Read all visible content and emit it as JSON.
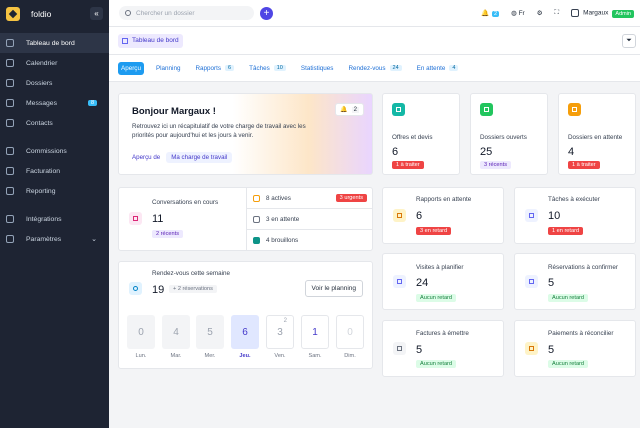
{
  "brand": "foldio",
  "sidebar": {
    "items": [
      {
        "label": "Tableau de bord",
        "active": true
      },
      {
        "label": "Calendrier"
      },
      {
        "label": "Dossiers"
      },
      {
        "label": "Messages",
        "badge": "8"
      },
      {
        "label": "Contacts"
      },
      {
        "label": "Commissions"
      },
      {
        "label": "Facturation"
      },
      {
        "label": "Reporting"
      },
      {
        "label": "Intégrations"
      },
      {
        "label": "Paramètres"
      }
    ]
  },
  "topbar": {
    "search_placeholder": "Chercher un dossier",
    "notif_count": "2",
    "lang": "Fr",
    "user": "Margaux",
    "role": "Admin"
  },
  "breadcrumb": "Tableau de bord",
  "tabs": [
    {
      "label": "Aperçu"
    },
    {
      "label": "Planning"
    },
    {
      "label": "Rapports",
      "count": "6"
    },
    {
      "label": "Tâches",
      "count": "10"
    },
    {
      "label": "Statistiques"
    },
    {
      "label": "Rendez-vous",
      "count": "24"
    },
    {
      "label": "En attente",
      "count": "4"
    }
  ],
  "welcome": {
    "title": "Bonjour Margaux !",
    "text1": "Retrouvez ici un récapitulatif de votre charge de travail avec les",
    "text2": "priorités pour aujourd'hui et les jours à venir.",
    "apercu": "Aperçu de",
    "link": "Ma charge de travail",
    "badge": "2"
  },
  "stats": [
    {
      "label": "Offres et devis",
      "value": "6",
      "pill": "1 à traiter",
      "color": "#14b8a6"
    },
    {
      "label": "Dossiers ouverts",
      "value": "25",
      "pill": "3 récents",
      "color": "#22c55e"
    },
    {
      "label": "Dossiers en attente",
      "value": "4",
      "pill": "1 à traiter",
      "color": "#f59e0b"
    }
  ],
  "conversations": {
    "label": "Conversations en cours",
    "value": "11",
    "pill": "2 récents",
    "rows": [
      {
        "label": "8 actives",
        "pill": "3 urgents"
      },
      {
        "label": "3 en attente"
      },
      {
        "label": "4 brouillons"
      }
    ]
  },
  "rdv": {
    "label": "Rendez-vous cette semaine",
    "value": "19",
    "sub": "+ 2 réservations",
    "button": "Voir le planning",
    "days": [
      {
        "num": "0",
        "label": "Lun."
      },
      {
        "num": "4",
        "label": "Mar."
      },
      {
        "num": "5",
        "label": "Mer."
      },
      {
        "num": "6",
        "label": "Jeu.",
        "today": true
      },
      {
        "num": "3",
        "label": "Ven.",
        "extra": "2"
      },
      {
        "num": "1",
        "label": "Sam."
      },
      {
        "num": "0",
        "label": "Dim."
      }
    ]
  },
  "small_cards": [
    {
      "label": "Rapports en attente",
      "value": "6",
      "pill": "3 en retard",
      "kind": "red"
    },
    {
      "label": "Tâches à exécuter",
      "value": "10",
      "pill": "1 en retard",
      "kind": "red"
    },
    {
      "label": "Visites à planifier",
      "value": "24",
      "pill": "Aucun retard",
      "kind": "green"
    },
    {
      "label": "Réservations à confirmer",
      "value": "5",
      "pill": "Aucun retard",
      "kind": "green"
    },
    {
      "label": "Factures à émettre",
      "value": "5",
      "pill": "Aucun retard",
      "kind": "green"
    },
    {
      "label": "Paiements à réconcilier",
      "value": "5",
      "pill": "Aucun retard",
      "kind": "green"
    }
  ]
}
